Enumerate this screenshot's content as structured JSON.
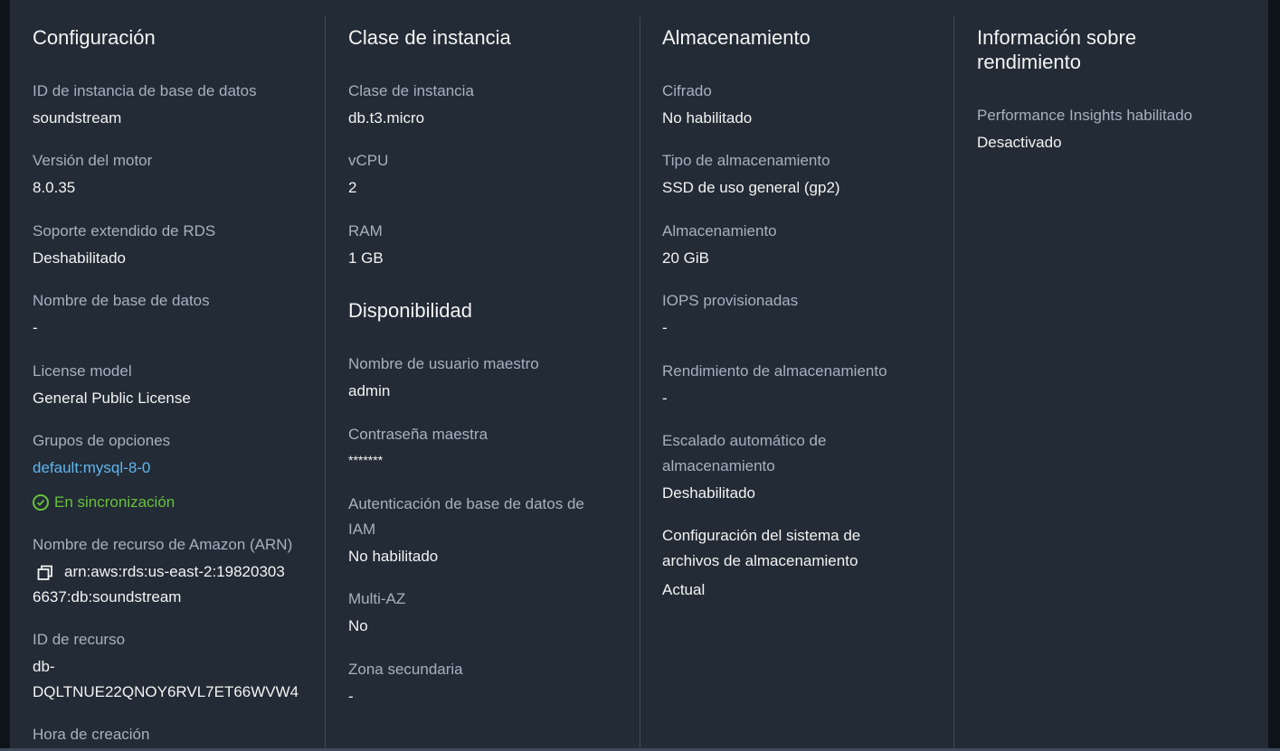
{
  "config": {
    "title": "Configuración",
    "db_instance_id_label": "ID de instancia de base de datos",
    "db_instance_id": "soundstream",
    "engine_version_label": "Versión del motor",
    "engine_version": "8.0.35",
    "extended_support_label": "Soporte extendido de RDS",
    "extended_support": "Deshabilitado",
    "db_name_label": "Nombre de base de datos",
    "db_name": "-",
    "license_model_label": "License model",
    "license_model": "General Public License",
    "option_groups_label": "Grupos de opciones",
    "option_group_link": "default:mysql-8-0",
    "option_group_status": "En sincronización",
    "arn_label": "Nombre de recurso de Amazon (ARN)",
    "arn_line1": "arn:aws:rds:us-east-2:19820303",
    "arn_line2": "6637:db:soundstream",
    "resource_id_label": "ID de recurso",
    "resource_id_line1": "db-",
    "resource_id_line2": "DQLTNUE22QNOY6RVL7ET66WVW4",
    "creation_time_label": "Hora de creación"
  },
  "instance_class": {
    "title": "Clase de instancia",
    "class_label": "Clase de instancia",
    "class": "db.t3.micro",
    "vcpu_label": "vCPU",
    "vcpu": "2",
    "ram_label": "RAM",
    "ram": "1 GB"
  },
  "availability": {
    "title": "Disponibilidad",
    "master_user_label": "Nombre de usuario maestro",
    "master_user": "admin",
    "master_password_label": "Contraseña maestra",
    "master_password": "*******",
    "iam_auth_label_line1": "Autenticación de base de datos de",
    "iam_auth_label_line2": "IAM",
    "iam_auth": "No habilitado",
    "multi_az_label": "Multi-AZ",
    "multi_az": "No",
    "secondary_zone_label": "Zona secundaria",
    "secondary_zone": "-"
  },
  "storage": {
    "title": "Almacenamiento",
    "encryption_label": "Cifrado",
    "encryption": "No habilitado",
    "storage_type_label": "Tipo de almacenamiento",
    "storage_type": "SSD de uso general (gp2)",
    "storage_label": "Almacenamiento",
    "storage": "20 GiB",
    "iops_label": "IOPS provisionadas",
    "iops": "-",
    "throughput_label": "Rendimiento de almacenamiento",
    "throughput": "-",
    "autoscaling_label_line1": "Escalado automático de",
    "autoscaling_label_line2": "almacenamiento",
    "autoscaling": "Deshabilitado",
    "fs_config_label_line1": "Configuración del sistema de",
    "fs_config_label_line2": "archivos de almacenamiento",
    "fs_config": "Actual"
  },
  "performance": {
    "title_line1": "Información sobre",
    "title_line2": "rendimiento",
    "pi_label": "Performance Insights habilitado",
    "pi": "Desactivado"
  },
  "colors": {
    "background": "#232b36",
    "label": "#a7b1bd",
    "value": "#f2f3f3",
    "link": "#5fb6ec",
    "success": "#67c23a"
  }
}
